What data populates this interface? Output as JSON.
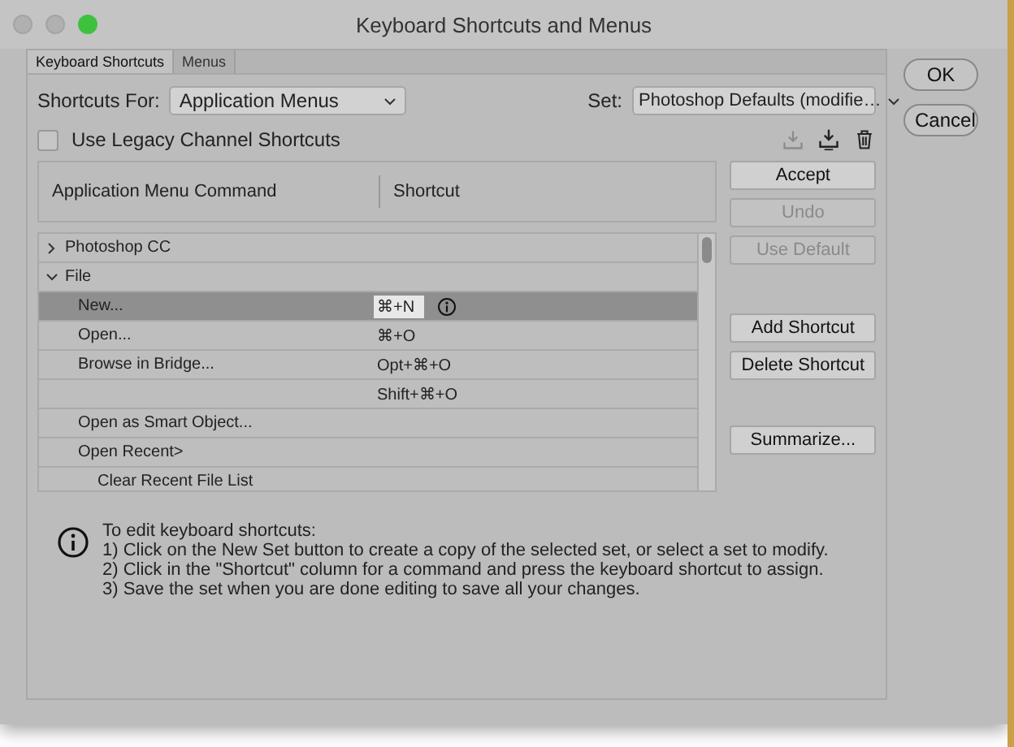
{
  "window": {
    "title": "Keyboard Shortcuts and Menus"
  },
  "tabs": [
    {
      "label": "Keyboard Shortcuts",
      "selected": true
    },
    {
      "label": "Menus",
      "selected": false
    }
  ],
  "shortcuts_for": {
    "label": "Shortcuts For:",
    "value": "Application Menus"
  },
  "set": {
    "label": "Set:",
    "value": "Photoshop Defaults (modifie…"
  },
  "legacy_channel": {
    "label": "Use Legacy Channel Shortcuts",
    "checked": false
  },
  "table": {
    "columns": [
      "Application Menu Command",
      "Shortcut"
    ],
    "rows": [
      {
        "command": "Photoshop CC",
        "expanded": false,
        "selected": false
      },
      {
        "command": "File",
        "expanded": true,
        "selected": false,
        "children": [
          {
            "command": "New...",
            "shortcut": "⌘+N",
            "selected": true
          },
          {
            "command": "Open...",
            "shortcut": "⌘+O",
            "selected": false
          },
          {
            "command": "Browse in Bridge...",
            "shortcut": "Opt+⌘+O",
            "selected": false
          },
          {
            "shortcut": "Shift+⌘+O",
            "selected": false
          },
          {
            "command": "Open as Smart Object...",
            "selected": false
          },
          {
            "command": "Open Recent>",
            "selected": false,
            "children": [
              {
                "command": "Clear Recent File List",
                "selected": false
              }
            ]
          }
        ]
      }
    ]
  },
  "side_buttons": [
    {
      "label": "Accept",
      "disabled": false
    },
    {
      "label": "Undo",
      "disabled": true
    },
    {
      "label": "Use Default",
      "disabled": true
    },
    {
      "label": "Add Shortcut",
      "disabled": false
    },
    {
      "label": "Delete Shortcut",
      "disabled": false
    },
    {
      "label": "Summarize...",
      "disabled": false
    }
  ],
  "help": {
    "lines": [
      "To edit keyboard shortcuts:",
      "1) Click on the New Set button to create a copy of the selected set, or select a set to modify.",
      "2) Click in the \"Shortcut\" column for a command and press the keyboard shortcut to assign.",
      "3) Save the set when you are done editing to save all your changes."
    ]
  },
  "dialog_buttons": [
    "OK",
    "Cancel"
  ]
}
